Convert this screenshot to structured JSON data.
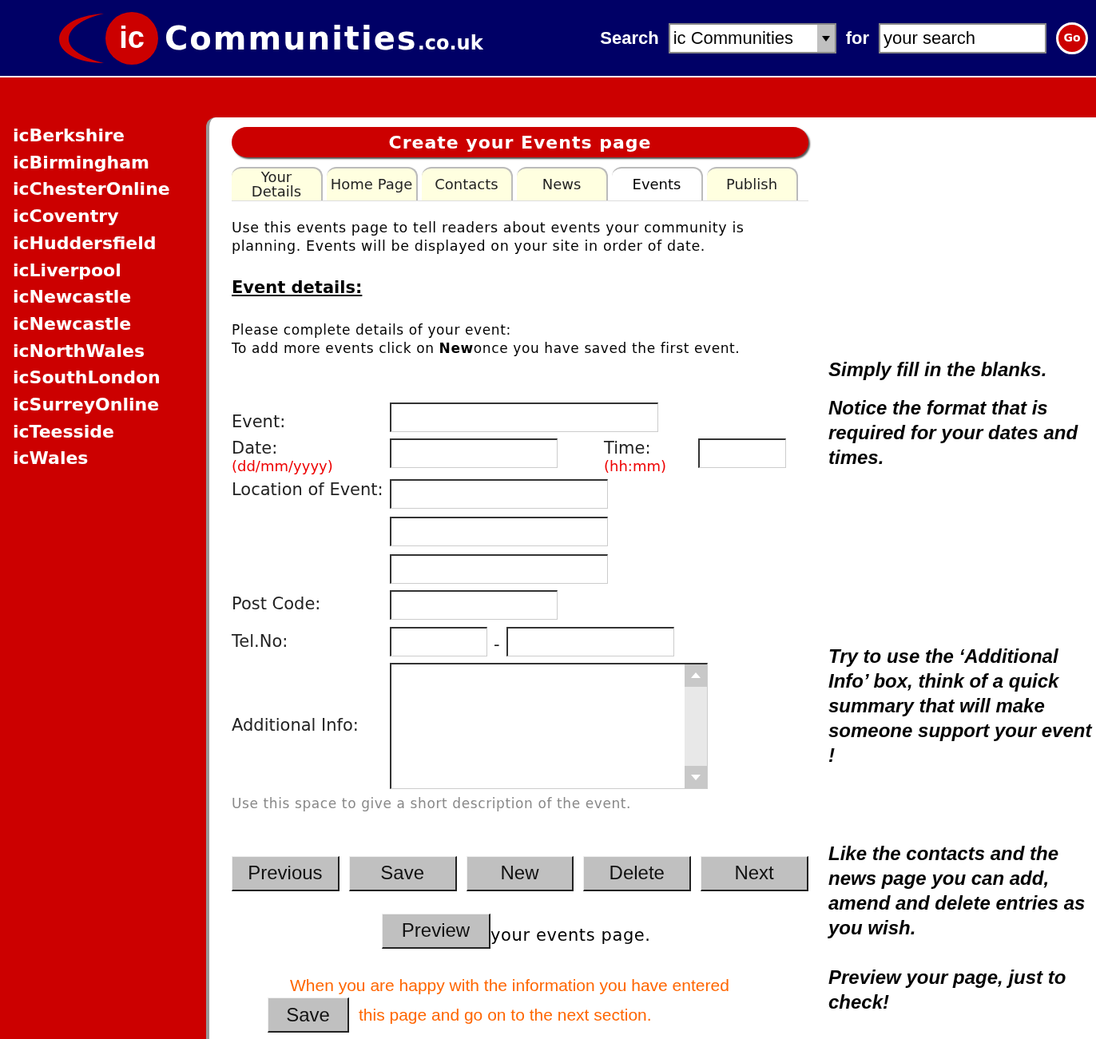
{
  "header": {
    "logo": {
      "prefix": "ic",
      "name": "Communities",
      "suffix": ".co.uk"
    },
    "search_label": "Search",
    "scope_select": {
      "value": "ic Communities"
    },
    "for_label": "for",
    "search_field": {
      "value": "your search"
    },
    "go_button": "Go"
  },
  "sidebar": {
    "items": [
      "icBerkshire",
      "icBirmingham",
      "icChesterOnline",
      "icCoventry",
      "icHuddersfield",
      "icLiverpool",
      "icNewcastle",
      "icNewcastle",
      "icNorthWales",
      "icSouthLondon",
      "icSurreyOnline",
      "icTeesside",
      "icWales"
    ]
  },
  "page_title": "Create your Events page",
  "tabs": [
    {
      "label": "Your Details",
      "selected": false
    },
    {
      "label": "Home Page",
      "selected": false
    },
    {
      "label": "Contacts",
      "selected": false
    },
    {
      "label": "News",
      "selected": false
    },
    {
      "label": "Events",
      "selected": true
    },
    {
      "label": "Publish",
      "selected": false
    }
  ],
  "intro": "Use this events page to tell readers about events your community is planning. Events will be displayed on your site in order of date.",
  "section_heading": "Event details:",
  "instructions": [
    "Please complete details of your event:",
    "To add more events click on **New**once you have saved the first event."
  ],
  "form": {
    "event_label": "Event:",
    "date_label": "Date:",
    "date_format": "(dd/mm/yyyy)",
    "time_label": "Time:",
    "time_format": "(hh:mm)",
    "location_label": "Location of Event:",
    "postcode_label": "Post Code:",
    "tel_label": "Tel.No:",
    "tel_separator": "-",
    "info_label": "Additional Info:",
    "info_hint": "Use this space to give a short description of the event."
  },
  "buttons": [
    "Previous",
    "Save",
    "New",
    "Delete",
    "Next"
  ],
  "preview": {
    "button": "Preview",
    "text": "your events page."
  },
  "save_note": {
    "line1": "When you are happy with the information you have entered",
    "button": "Save",
    "line2": "this page and go on to the next section."
  },
  "notes": [
    "Simply fill in the blanks.",
    "Notice the format that is required for your dates and times.",
    "Try to use the ‘Additional Info’ box, think of a quick summary that will make someone support your event !",
    "Like the contacts and the news page you can add, amend and delete entries as you wish.",
    "Preview your page, just to check!"
  ]
}
